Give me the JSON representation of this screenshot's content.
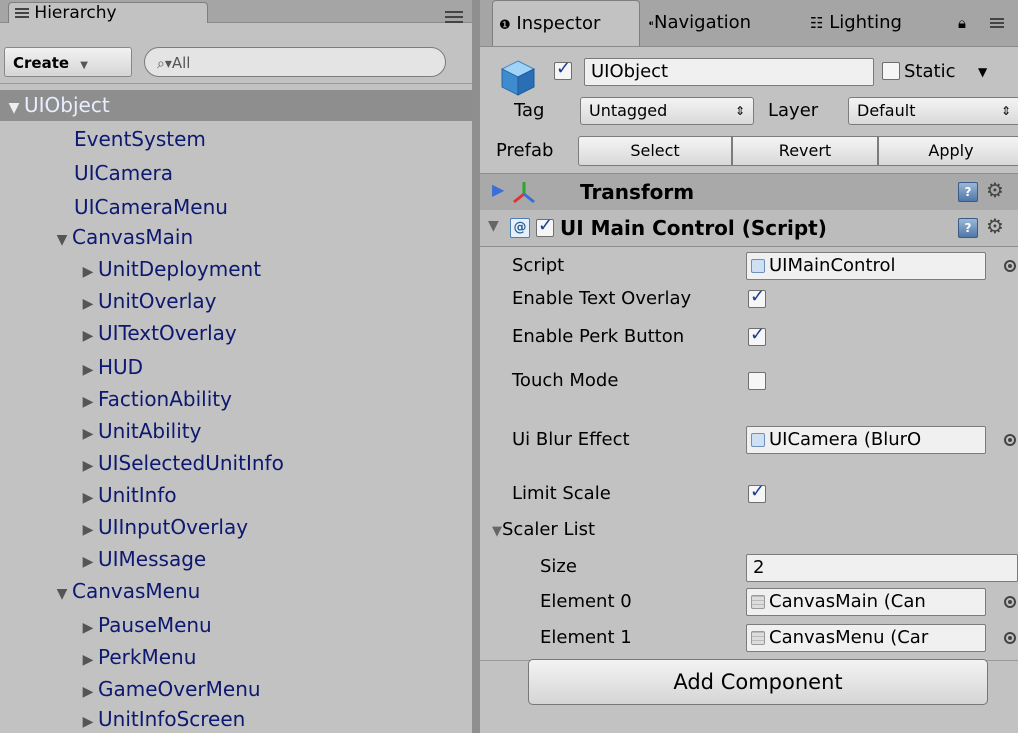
{
  "hierarchy": {
    "tab_label": "Hierarchy",
    "create_label": "Create",
    "search_placeholder": "All",
    "tree": [
      {
        "label": "UIObject",
        "expanded": true,
        "selected": true
      },
      {
        "label": "EventSystem"
      },
      {
        "label": "UICamera"
      },
      {
        "label": "UICameraMenu"
      },
      {
        "label": "CanvasMain",
        "expanded": true
      },
      {
        "label": "UnitDeployment",
        "collapsed": true
      },
      {
        "label": "UnitOverlay",
        "collapsed": true
      },
      {
        "label": "UITextOverlay",
        "collapsed": true
      },
      {
        "label": "HUD",
        "collapsed": true
      },
      {
        "label": "FactionAbility",
        "collapsed": true
      },
      {
        "label": "UnitAbility",
        "collapsed": true
      },
      {
        "label": "UISelectedUnitInfo",
        "collapsed": true
      },
      {
        "label": "UnitInfo",
        "collapsed": true
      },
      {
        "label": "UIInputOverlay",
        "collapsed": true
      },
      {
        "label": "UIMessage",
        "collapsed": true
      },
      {
        "label": "CanvasMenu",
        "expanded": true
      },
      {
        "label": "PauseMenu",
        "collapsed": true
      },
      {
        "label": "PerkMenu",
        "collapsed": true
      },
      {
        "label": "GameOverMenu",
        "collapsed": true
      },
      {
        "label": "UnitInfoScreen",
        "collapsed": true
      }
    ]
  },
  "inspector": {
    "tabs": [
      "Inspector",
      "Navigation",
      "Lighting"
    ],
    "object_name": "UIObject",
    "static_label": "Static",
    "tag_label": "Tag",
    "tag_value": "Untagged",
    "layer_label": "Layer",
    "layer_value": "Default",
    "prefab_label": "Prefab",
    "prefab_buttons": [
      "Select",
      "Revert",
      "Apply"
    ],
    "transform_title": "Transform",
    "script_title": "UI Main Control (Script)",
    "props": {
      "script_label": "Script",
      "script_value": "UIMainControl",
      "text_overlay_label": "Enable Text Overlay",
      "perk_button_label": "Enable Perk Button",
      "touch_mode_label": "Touch Mode",
      "blur_label": "Ui Blur Effect",
      "blur_value": "UICamera (BlurO",
      "limit_scale_label": "Limit Scale",
      "scaler_list_label": "Scaler List",
      "size_label": "Size",
      "size_value": "2",
      "element0_label": "Element 0",
      "element0_value": "CanvasMain (Can",
      "element1_label": "Element 1",
      "element1_value": "CanvasMenu (Car"
    },
    "add_component_label": "Add Component"
  }
}
